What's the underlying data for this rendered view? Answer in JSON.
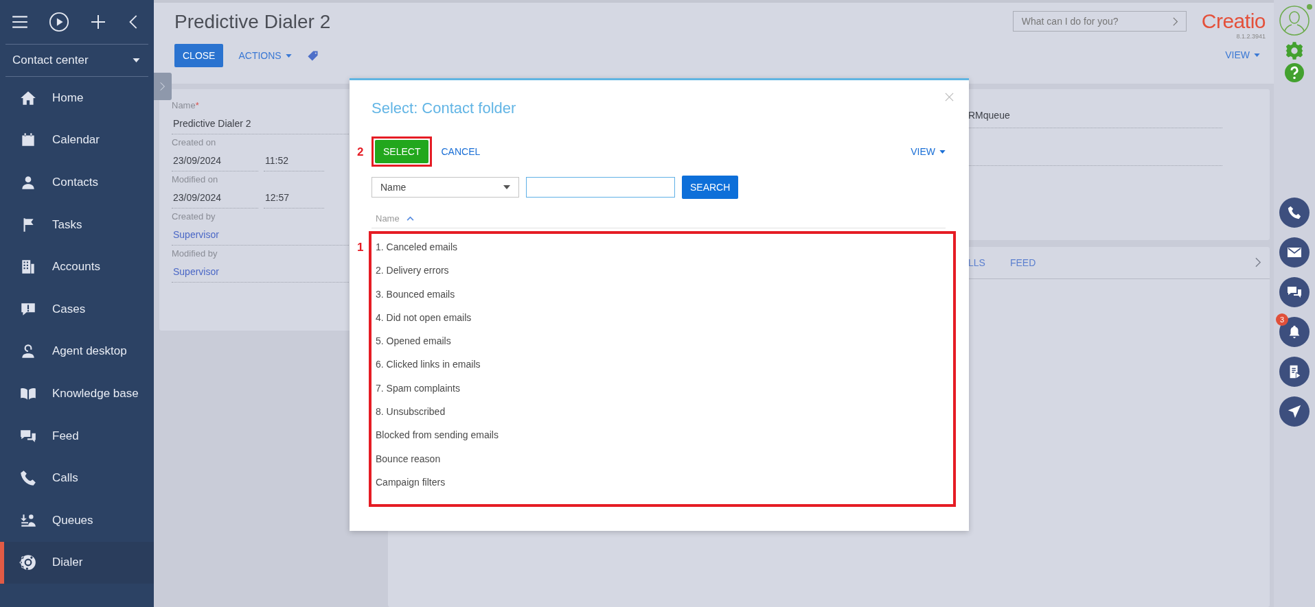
{
  "sidebar": {
    "workplace": "Contact center",
    "items": [
      {
        "label": "Home",
        "selected": false
      },
      {
        "label": "Calendar",
        "selected": false
      },
      {
        "label": "Contacts",
        "selected": false
      },
      {
        "label": "Tasks",
        "selected": false
      },
      {
        "label": "Accounts",
        "selected": false
      },
      {
        "label": "Cases",
        "selected": false
      },
      {
        "label": "Agent desktop",
        "selected": false
      },
      {
        "label": "Knowledge base",
        "selected": false
      },
      {
        "label": "Feed",
        "selected": false
      },
      {
        "label": "Calls",
        "selected": false
      },
      {
        "label": "Queues",
        "selected": false
      },
      {
        "label": "Dialer",
        "selected": true
      }
    ]
  },
  "page": {
    "title": "Predictive Dialer 2",
    "actions": [
      {
        "label": "CLOSE",
        "kind": "primary"
      },
      {
        "label": "ACTIONS",
        "kind": "menu"
      }
    ],
    "view": "VIEW"
  },
  "search": {
    "placeholder": "What can I do for you?"
  },
  "logo": {
    "text": "Creatio",
    "version": "8.1.2.3941"
  },
  "details": {
    "fields": [
      {
        "label": "Name",
        "required_mark": "*",
        "value": "Predictive Dialer 2",
        "kind": "text"
      },
      {
        "label": "Created on",
        "value": "23/09/2024",
        "time": "11:52",
        "kind": "datetime"
      },
      {
        "label": "Modified on",
        "value": "23/09/2024",
        "time": "12:57",
        "kind": "datetime"
      },
      {
        "label": "Created by",
        "value": "Supervisor",
        "kind": "link"
      },
      {
        "label": "Modified by",
        "value": "Supervisor",
        "kind": "link"
      }
    ]
  },
  "background_card": {
    "field_value": "RMqueue",
    "tabs": [
      "LLS",
      "FEED"
    ]
  },
  "notifications": {
    "badge": "3"
  },
  "dialog": {
    "title": "Select: Contact folder",
    "select_button": "SELECT",
    "cancel_button": "CANCEL",
    "view": "VIEW",
    "filter_column": "Name",
    "search_button": "SEARCH",
    "column": "Name",
    "rows": [
      "1. Canceled emails",
      "2. Delivery errors",
      "3. Bounced emails",
      "4. Did not open emails",
      "5. Opened emails",
      "6. Clicked links in emails",
      "7. Spam complaints",
      "8. Unsubscribed",
      "Blocked from sending emails",
      "Bounce reason",
      "Campaign filters"
    ],
    "callouts": [
      "2",
      "1"
    ]
  }
}
